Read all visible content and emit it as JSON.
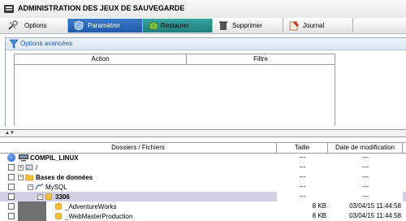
{
  "window": {
    "title": "ADMINISTRATION DES JEUX DE SAUVEGARDE"
  },
  "tabs": [
    {
      "label": "Options",
      "icon": "wrench-icon"
    },
    {
      "label": "Paramètrer",
      "icon": "shield-icon"
    },
    {
      "label": "Restaurer",
      "icon": "restore-box-icon"
    },
    {
      "label": "Supprimer",
      "icon": "delete-icon"
    },
    {
      "label": "Journal",
      "icon": "journal-icon"
    }
  ],
  "options_panel": {
    "title": "Options avancées",
    "columns": [
      "Action",
      "Filtre"
    ]
  },
  "files_table": {
    "columns": [
      "Dossiers / Fichiers",
      "Taille",
      "Date de modification"
    ],
    "rows": [
      {
        "name": "COMPIL_LINUX",
        "size": "---",
        "date": "---"
      },
      {
        "name": "/",
        "size": "---",
        "date": "---"
      },
      {
        "name": "Bases de données",
        "size": "---",
        "date": "---"
      },
      {
        "name": "MySQL",
        "size": "---",
        "date": "---"
      },
      {
        "name": "3306",
        "size": "---",
        "date": "---"
      },
      {
        "name": "_AdventureWorks",
        "size": "8 KB",
        "date": "03/04/15 11:44:58"
      },
      {
        "name": "_WebMasterProduction",
        "size": "8 KB",
        "date": "03/04/15 11:44:58"
      }
    ]
  },
  "colors": {
    "accent_blue": "#1f5aa8",
    "active_teal": "#207c7c",
    "selection": "#d3d0e4"
  }
}
